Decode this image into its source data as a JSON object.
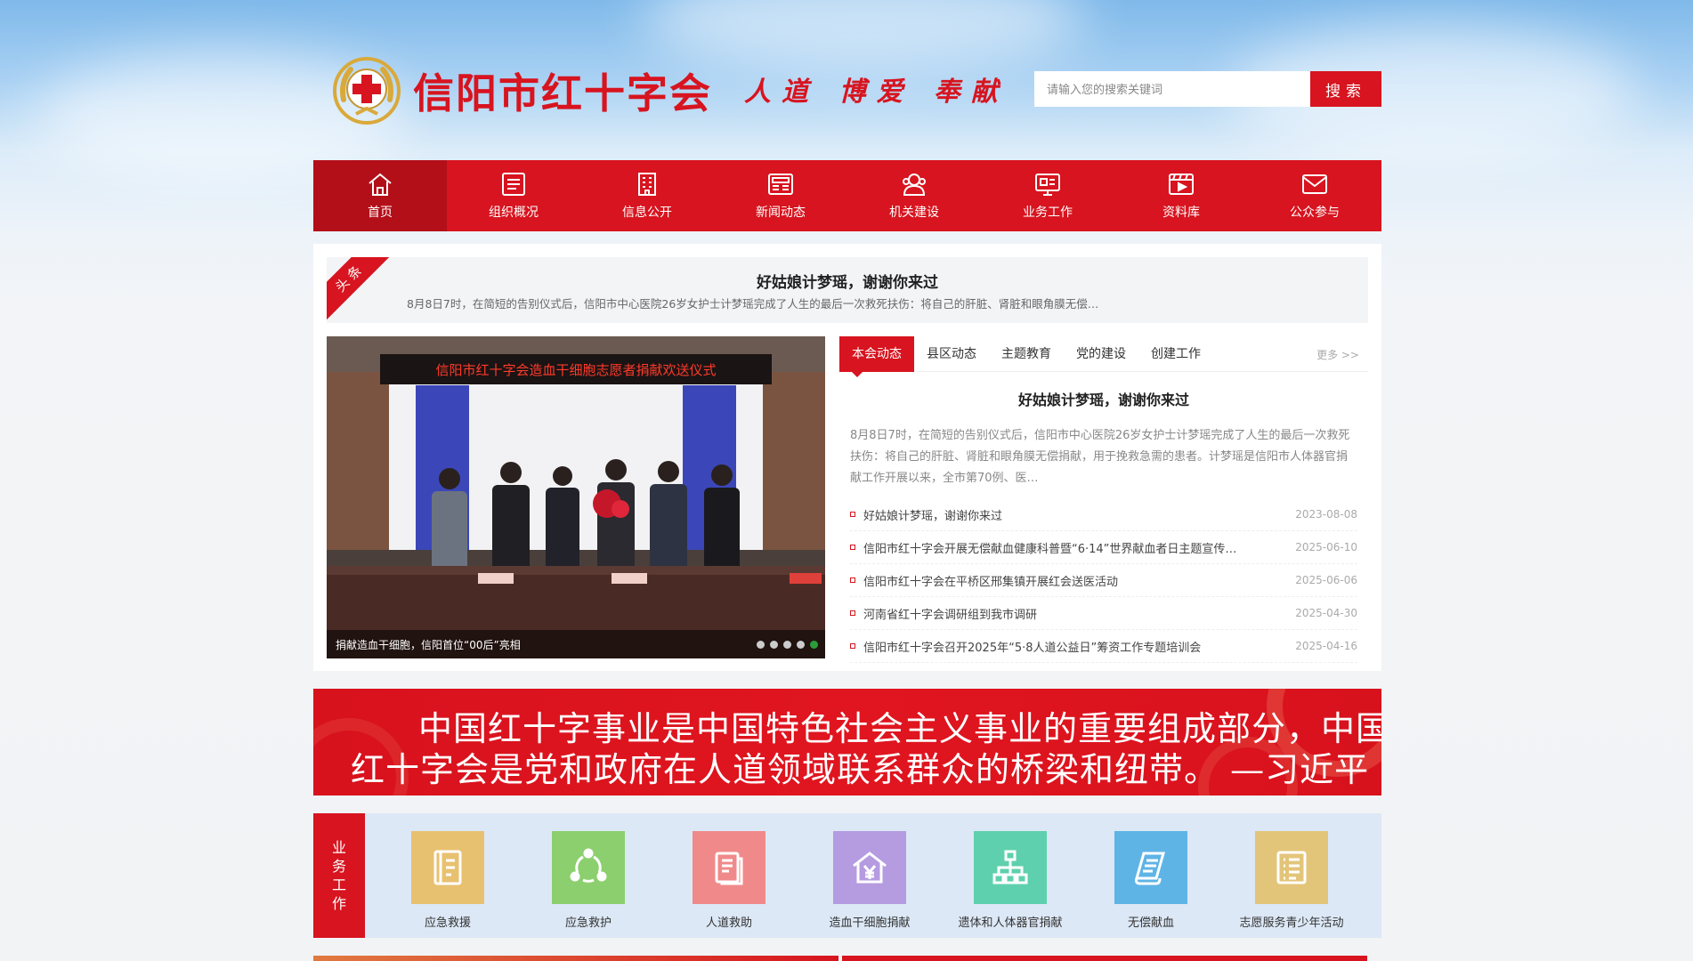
{
  "header": {
    "logo_text": "信阳市红十字会",
    "slogan": "人道 博爱 奉献",
    "search_placeholder": "请输入您的搜索关键词",
    "search_button": "搜索"
  },
  "nav": {
    "items": [
      {
        "label": "首页",
        "icon": "home-icon"
      },
      {
        "label": "组织概况",
        "icon": "list-icon"
      },
      {
        "label": "信息公开",
        "icon": "building-icon"
      },
      {
        "label": "新闻动态",
        "icon": "newspaper-icon"
      },
      {
        "label": "机关建设",
        "icon": "people-icon"
      },
      {
        "label": "业务工作",
        "icon": "monitor-icon"
      },
      {
        "label": "资料库",
        "icon": "video-icon"
      },
      {
        "label": "公众参与",
        "icon": "mail-icon"
      }
    ]
  },
  "headline": {
    "badge": "头条",
    "title": "好姑娘计梦瑶，谢谢你来过",
    "summary": "8月8日7时，在简短的告别仪式后，信阳市中心医院26岁女护士计梦瑶完成了人生的最后一次救死扶伤：将自己的肝脏、肾脏和眼角膜无偿…"
  },
  "slider": {
    "banner_text": "信阳市红十字会造血干细胞志愿者捐献欢送仪式",
    "caption": "捐献造血干细胞，信阳首位“00后”亮相"
  },
  "news": {
    "tabs": [
      "本会动态",
      "县区动态",
      "主题教育",
      "党的建设",
      "创建工作"
    ],
    "more": "更多 >>",
    "featured_title": "好姑娘计梦瑶，谢谢你来过",
    "featured_summary": "8月8日7时，在简短的告别仪式后，信阳市中心医院26岁女护士计梦瑶完成了人生的最后一次救死扶伤：将自己的肝脏、肾脏和眼角膜无偿捐献，用于挽救急需的患者。计梦瑶是信阳市人体器官捐献工作开展以来，全市第70例、医…",
    "items": [
      {
        "title": "好姑娘计梦瑶，谢谢你来过",
        "date": "2023-08-08"
      },
      {
        "title": "信阳市红十字会开展无偿献血健康科普暨“6·14”世界献血者日主题宣传…",
        "date": "2025-06-10"
      },
      {
        "title": "信阳市红十字会在平桥区邢集镇开展红会送医活动",
        "date": "2025-06-06"
      },
      {
        "title": "河南省红十字会调研组到我市调研",
        "date": "2025-04-30"
      },
      {
        "title": "信阳市红十字会召开2025年“5·8人道公益日”筹资工作专题培训会",
        "date": "2025-04-16"
      }
    ]
  },
  "quote": {
    "line1": "中国红十字事业是中国特色社会主义事业的重要组成部分，中国",
    "line2": "红十字会是党和政府在人道领域联系群众的桥梁和纽带。  —习近平"
  },
  "business": {
    "label_chars": [
      "业",
      "务",
      "工",
      "作"
    ],
    "items": [
      {
        "label": "应急救援",
        "icon": "notebook-icon",
        "color": "#e8c170"
      },
      {
        "label": "应急救护",
        "icon": "cycle-icon",
        "color": "#8ccf6e"
      },
      {
        "label": "人道救助",
        "icon": "document-icon",
        "color": "#f08a8a"
      },
      {
        "label": "造血干细胞捐献",
        "icon": "house-yen-icon",
        "color": "#b59be0"
      },
      {
        "label": "遗体和人体器官捐献",
        "icon": "org-chart-icon",
        "color": "#5fd0ad"
      },
      {
        "label": "无偿献血",
        "icon": "scroll-icon",
        "color": "#5fb4e6"
      },
      {
        "label": "志愿服务青少年活动",
        "icon": "checklist-icon",
        "color": "#e3c57a"
      }
    ]
  },
  "colors": {
    "brand_red": "#d7141f",
    "nav_active": "#b30f19",
    "bullet_active": "#2a9d3a"
  }
}
